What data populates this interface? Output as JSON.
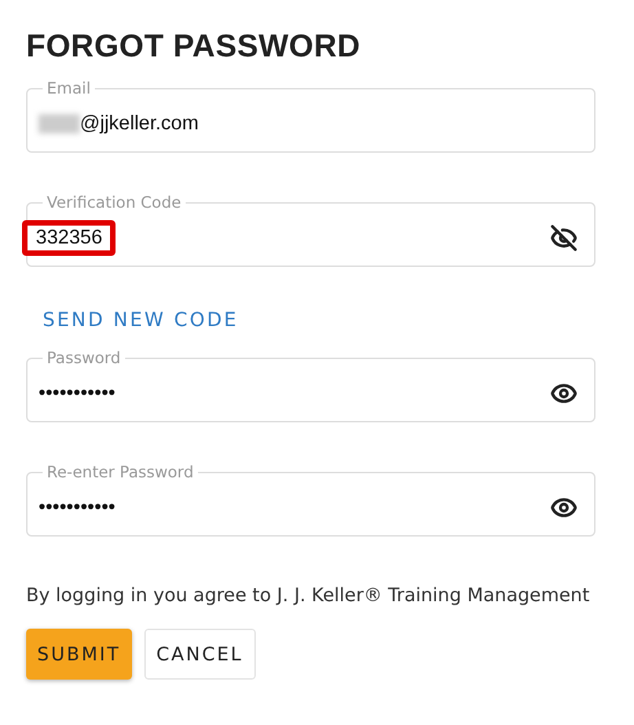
{
  "title": "FORGOT PASSWORD",
  "fields": [
    {
      "label": "Email",
      "value": "@jjkeller.com",
      "redacted_prefix": true,
      "highlighted": false
    },
    {
      "label": "Verification Code",
      "value": "332356",
      "redacted_prefix": false,
      "highlighted": true,
      "revealed": true
    },
    {
      "label": "Password",
      "value": "•••••••••••",
      "redacted_prefix": false,
      "highlighted": false,
      "revealed": false
    },
    {
      "label": "Re-enter Password",
      "value": "•••••••••••",
      "redacted_prefix": false,
      "highlighted": false,
      "revealed": false
    }
  ],
  "send_code_link": "SEND NEW CODE",
  "agreement": "By logging in you agree to J. J. Keller® Training Management",
  "buttons": [
    {
      "label": "SUBMIT",
      "kind": "primary"
    },
    {
      "label": "CANCEL",
      "kind": "secondary"
    }
  ]
}
